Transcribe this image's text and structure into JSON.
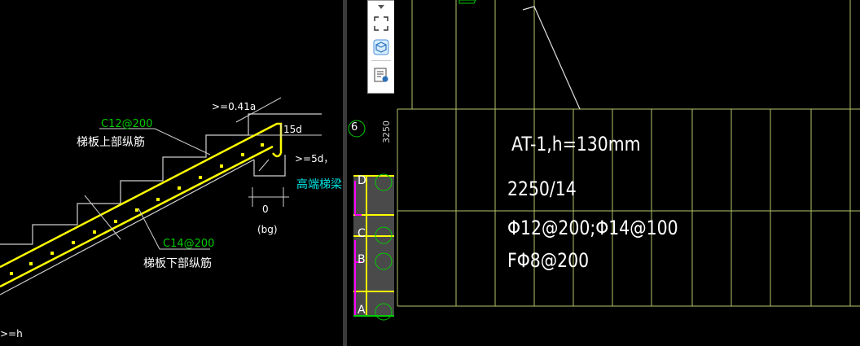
{
  "left_view": {
    "annotations": {
      "top_bar_text": "C12@200",
      "top_bar_desc": "梯板上部纵筋",
      "bottom_bar_text": "C14@200",
      "bottom_bar_desc": "梯板下部纵筋",
      "dim_041": ">=0.41a",
      "dim_15d": "15d",
      "dim_5d": ">=5d，",
      "high_end_label": "高端梯梁",
      "dim_zero": "0",
      "bg_label": "(bg)",
      "bottom_left": ">=h"
    }
  },
  "mid_view": {
    "axis_labels": [
      "D",
      "C",
      "B",
      "A"
    ],
    "grid_number": "6",
    "vertical_text": "3250"
  },
  "toolbar": {
    "dropdown_icon": "caret-down-icon",
    "select_icon": "select-frame-icon",
    "view3d_icon": "cube-3d-icon",
    "layer_icon": "layer-list-icon"
  },
  "right_view": {
    "line1": "AT-1,h=130mm",
    "line2": "2250/14",
    "line3": "Φ12@200;Φ14@100",
    "line4": "FΦ8@200"
  },
  "colors": {
    "background": "#000000",
    "rebar": "#ffff00",
    "green_text": "#00cc00",
    "cyan_text": "#00e5e5",
    "white_line": "#e0e0e0",
    "grid_line": "#b4c66a",
    "magenta": "#ff00ff"
  }
}
